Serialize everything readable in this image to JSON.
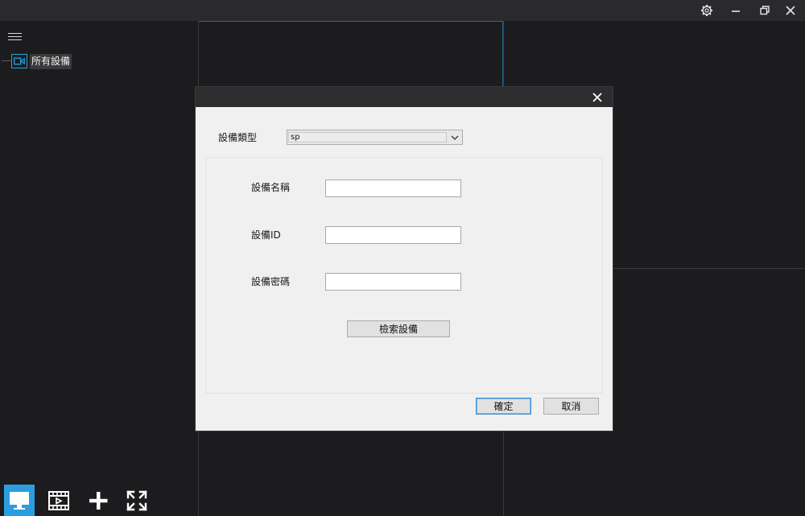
{
  "colors": {
    "accent": "#2a9ee0",
    "app_background": "#1c1c1e",
    "dialog_background": "#f0f0f0"
  },
  "titlebar": {
    "icons": [
      "gear-icon",
      "minimize-icon",
      "restore-icon",
      "close-icon"
    ]
  },
  "sidebar": {
    "tree_root_label": "所有設備"
  },
  "bottom_toolbar": {
    "icons": [
      "monitor-icon",
      "playback-film-icon",
      "add-icon",
      "fullscreen-icon"
    ]
  },
  "dialog": {
    "device_type_label": "設備類型",
    "device_type_value": "sp",
    "device_name_label": "設備名稱",
    "device_name_value": "",
    "device_id_label": "設備ID",
    "device_id_value": "",
    "device_password_label": "設備密碼",
    "device_password_value": "",
    "search_button": "檢索設備",
    "ok_button": "確定",
    "cancel_button": "取消"
  }
}
